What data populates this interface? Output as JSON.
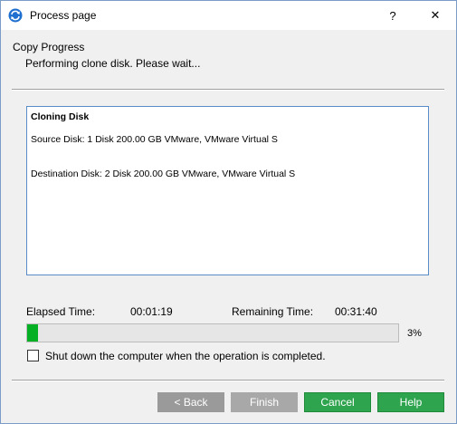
{
  "window": {
    "title": "Process page",
    "help_symbol": "?",
    "close_symbol": "✕",
    "icon": "app-refresh-icon"
  },
  "header": {
    "heading": "Copy Progress",
    "subheading": "Performing clone disk. Please wait..."
  },
  "info": {
    "title": "Cloning Disk",
    "source": "Source Disk: 1 Disk 200.00 GB VMware, VMware Virtual S",
    "destination": "Destination Disk: 2 Disk 200.00 GB VMware, VMware Virtual S"
  },
  "timing": {
    "elapsed_label": "Elapsed Time:",
    "elapsed_value": "00:01:19",
    "remaining_label": "Remaining Time:",
    "remaining_value": "00:31:40"
  },
  "progress": {
    "percent": 3,
    "percent_text": "3%",
    "color": "#06b025"
  },
  "shutdown_option": {
    "label": "Shut down the computer when the operation is completed.",
    "checked": false
  },
  "buttons": {
    "back": "< Back",
    "finish": "Finish",
    "cancel": "Cancel",
    "help": "Help"
  }
}
